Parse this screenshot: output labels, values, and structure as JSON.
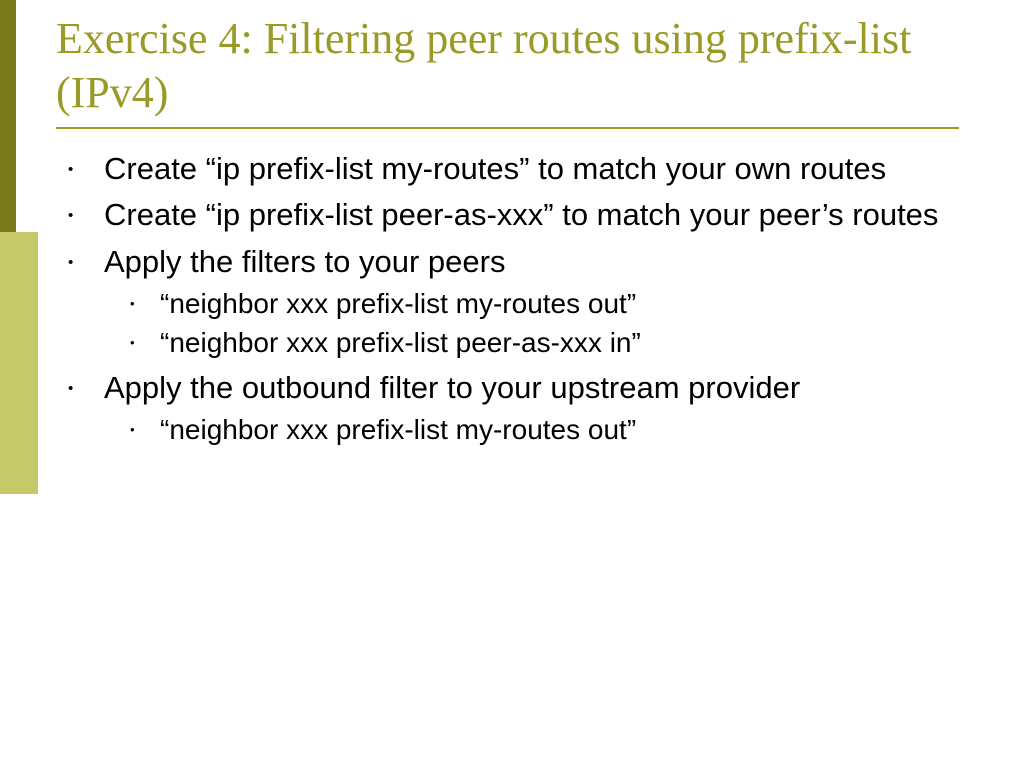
{
  "title": "Exercise 4: Filtering peer routes using prefix-list (IPv4)",
  "bullets": {
    "b1": "Create  “ip prefix-list my-routes” to match your own routes",
    "b2": "Create “ip prefix-list peer-as-xxx” to match your peer’s routes",
    "b3": "Apply the filters to your peers",
    "b3_sub": {
      "s1": "“neighbor xxx prefix-list my-routes out”",
      "s2": "“neighbor xxx prefix-list peer-as-xxx in”"
    },
    "b4": "Apply the outbound filter to your upstream provider",
    "b4_sub": {
      "s1": "“neighbor xxx prefix-list my-routes out”"
    }
  }
}
